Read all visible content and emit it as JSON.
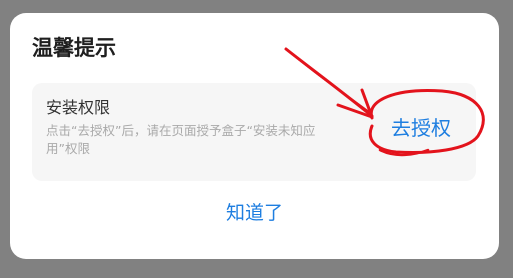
{
  "dialog": {
    "title": "温馨提示",
    "permission": {
      "title": "安装权限",
      "description": "点击“去授权”后，请在页面授予盒子“安装未知应用”权限",
      "authorize_label": "去授权"
    },
    "ok_label": "知道了"
  },
  "colors": {
    "accent": "#1e7ee0",
    "overlay": "#818181",
    "annotation": "#e3131c"
  }
}
